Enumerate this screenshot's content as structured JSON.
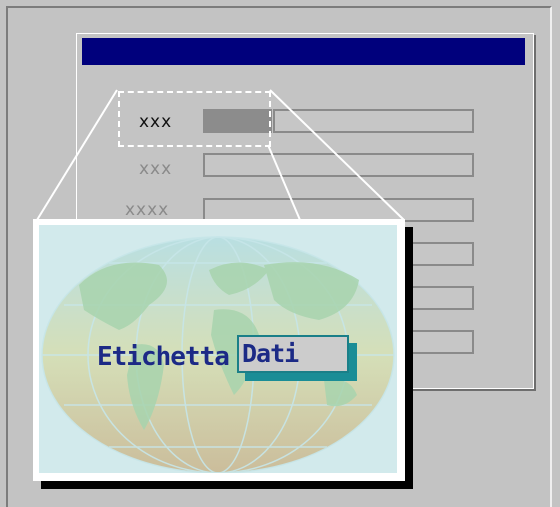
{
  "form": {
    "fields": [
      {
        "label": "xxx"
      },
      {
        "label": "xxx"
      },
      {
        "label": "xxxx"
      },
      {
        "label": ""
      },
      {
        "label": ""
      },
      {
        "label": ""
      }
    ]
  },
  "zoom": {
    "label": "Etichetta",
    "value": "Dati"
  },
  "colors": {
    "titlebar": "#00007c",
    "accent": "#1a8d96",
    "text": "#1c2a86"
  },
  "icons": {
    "background": "world-map-icon"
  }
}
